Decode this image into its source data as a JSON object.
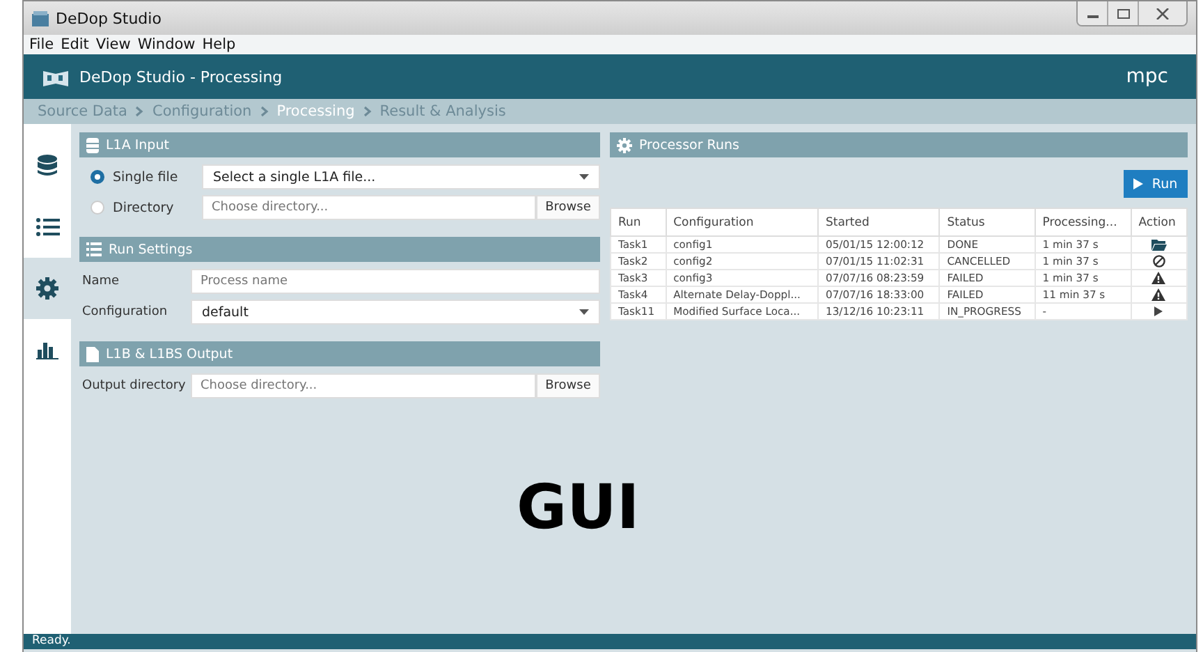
{
  "window": {
    "title": "DeDop Studio"
  },
  "menu": [
    "File",
    "Edit",
    "View",
    "Window",
    "Help"
  ],
  "app_header": {
    "title": "DeDop Studio - Processing",
    "brand": "mpc"
  },
  "breadcrumb": [
    {
      "label": "Source Data",
      "selected": false
    },
    {
      "label": "Configuration",
      "selected": false
    },
    {
      "label": "Processing",
      "selected": true
    },
    {
      "label": "Result & Analysis",
      "selected": false
    }
  ],
  "sidebar": [
    {
      "kind": "database",
      "selected": false
    },
    {
      "kind": "list",
      "selected": false
    },
    {
      "kind": "gear",
      "selected": true
    },
    {
      "kind": "chart",
      "selected": false
    }
  ],
  "l1a_input": {
    "title": "L1A Input",
    "options": [
      {
        "label": "Single file",
        "selected": true,
        "kind": "dropdown",
        "value": "Select a single L1A file..."
      },
      {
        "label": "Directory",
        "selected": false,
        "kind": "browse",
        "placeholder": "Choose directory...",
        "button": "Browse"
      }
    ]
  },
  "run_settings": {
    "title": "Run Settings",
    "name_label": "Name",
    "name_placeholder": "Process name",
    "config_label": "Configuration",
    "config_value": "default"
  },
  "output": {
    "title": "L1B & L1BS Output",
    "label": "Output directory",
    "placeholder": "Choose directory...",
    "button": "Browse"
  },
  "processor_runs": {
    "title": "Processor Runs",
    "run_button": "Run",
    "columns": [
      "Run",
      "Configuration",
      "Started",
      "Status",
      "Processing...",
      "Action"
    ],
    "rows": [
      {
        "run": "Task1",
        "configuration": "config1",
        "started": "05/01/15 12:00:12",
        "status": "DONE",
        "processing": "1 min 37 s",
        "kind": "folder"
      },
      {
        "run": "Task2",
        "configuration": "config2",
        "started": "07/01/15 11:02:31",
        "status": "CANCELLED",
        "processing": "1 min 37 s",
        "kind": "cancel"
      },
      {
        "run": "Task3",
        "configuration": "config3",
        "started": "07/07/16 08:23:59",
        "status": "FAILED",
        "processing": "1 min 37 s",
        "kind": "warning"
      },
      {
        "run": "Task4",
        "configuration": "Alternate Delay-Doppl...",
        "started": "07/07/16 18:33:00",
        "status": "FAILED",
        "processing": "11 min 37 s",
        "kind": "warning"
      },
      {
        "run": "Task11",
        "configuration": "Modified Surface Loca...",
        "started": "13/12/16 10:23:11",
        "status": "IN_PROGRESS",
        "processing": "-",
        "kind": "play"
      }
    ]
  },
  "overlay_label": "GUI",
  "status_bar": "Ready."
}
